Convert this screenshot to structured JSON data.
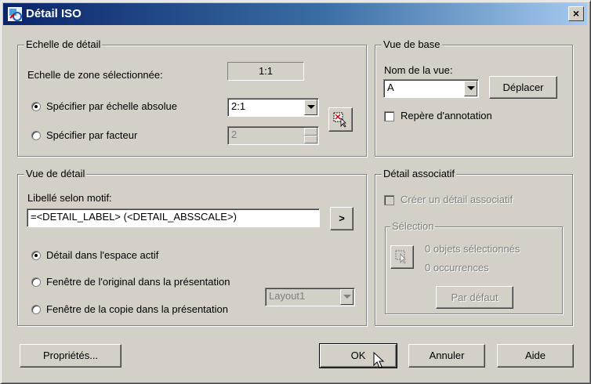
{
  "window": {
    "title": "Détail ISO",
    "close_label": "×"
  },
  "echelle": {
    "legend": "Echelle de détail",
    "zone_label": "Echelle de zone sélectionnée:",
    "zone_value": "1:1",
    "opt_absolue": "Spécifier par échelle absolue",
    "absolue_value": "2:1",
    "opt_facteur": "Spécifier par facteur",
    "facteur_value": "2"
  },
  "vue_base": {
    "legend": "Vue de base",
    "nom_label": "Nom de la vue:",
    "nom_value": "A",
    "deplacer_label": "Déplacer",
    "repere_label": "Repère d'annotation"
  },
  "vue_detail": {
    "legend": "Vue de détail",
    "libelle_label": "Libellé selon motif:",
    "libelle_value": "=<DETAIL_LABEL> (<DETAIL_ABSSCALE>)",
    "more_label": ">",
    "opt_espace": "Détail dans l'espace actif",
    "opt_original": "Fenêtre de l'original dans la présentation",
    "opt_copie": "Fenêtre de la copie dans la présentation",
    "layout_value": "Layout1"
  },
  "associatif": {
    "legend": "Détail associatif",
    "creer_label": "Créer un détail associatif",
    "selection_legend": "Sélection",
    "objets_label": "0 objets sélectionnés",
    "occurrences_label": "0 occurrences",
    "par_defaut_label": "Par défaut"
  },
  "footer": {
    "proprietes_label": "Propriétés...",
    "ok_label": "OK",
    "annuler_label": "Annuler",
    "aide_label": "Aide"
  }
}
